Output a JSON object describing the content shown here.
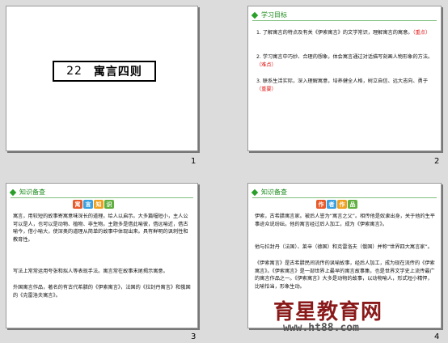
{
  "slide1": {
    "number": "22",
    "title": "寓言四则",
    "page": "1"
  },
  "slide2": {
    "heading": "学习目标",
    "page": "2",
    "items": [
      {
        "text": "1. 了解寓言的特点及有关《伊索寓言》的文学常识，理解寓言的寓意。",
        "tag": "（重点）"
      },
      {
        "text": "2. 学习寓言中巧妙、合理的想象，体会寓言通过对话描写刻画人物形象的方法。",
        "tag": "（难点）"
      },
      {
        "text": "3. 联系生活实际，深入理解寓意，培养健全人格，树立自信、远大志向、勇于",
        "tag": "（重要）"
      }
    ]
  },
  "slide3": {
    "heading": "知识备查",
    "badge": [
      "寓",
      "言",
      "知",
      "识"
    ],
    "page": "3",
    "p1": "寓言，用较短的故事寄寓意味深长的道理。给人以启示。大多篇幅短小，主人公可以是人，也可以是动物、植物、非生物。主题多是借此喻彼，借远喻近，借古喻今，借小喻大，使深奥的道理从简单的故事中体现出来。具有鲜明的讽刺性和教育性。",
    "p2": "写法上常常运用夸张和拟人等表现手法。寓言常在故事末尾揭示寓意。",
    "p3": "外国寓言作品，著名的有古代希腊的《伊索寓言》，法国的《拉封丹寓言》和俄国的《克雷洛夫寓言》。"
  },
  "slide4": {
    "heading": "知识备查",
    "badge": [
      "作",
      "者",
      "作",
      "品"
    ],
    "page": "4",
    "p1": "伊索，古希腊寓言家。被后人誉为“寓言之父”。相传他是奴隶出身，关于他的生平事迹众说纷纭。他的寓言经过后人加工，成为《伊索寓言》。",
    "p2": "他与拉封丹（法国）、莱辛（德国）和克雷洛夫（俄国）并称“世界四大寓言家”。",
    "p3": "《伊索寓言》是古希腊民间流传的讽喻故事，经后人加工，成为现在流传的《伊索寓言》。《伊索寓言》是一部世界上最早的寓言故事集，也是世界文学史上流传最广的寓言作品之一。《伊索寓言》大多是动物的故事，以动物喻人，形式短小精悍，比喻恰当，形象生动。"
  },
  "watermark": {
    "cn": "育星教育网",
    "url": "www.ht88.com"
  },
  "colors": {
    "green": "#2aa02a",
    "red": "#e01010",
    "blue": "#1a1aff"
  }
}
